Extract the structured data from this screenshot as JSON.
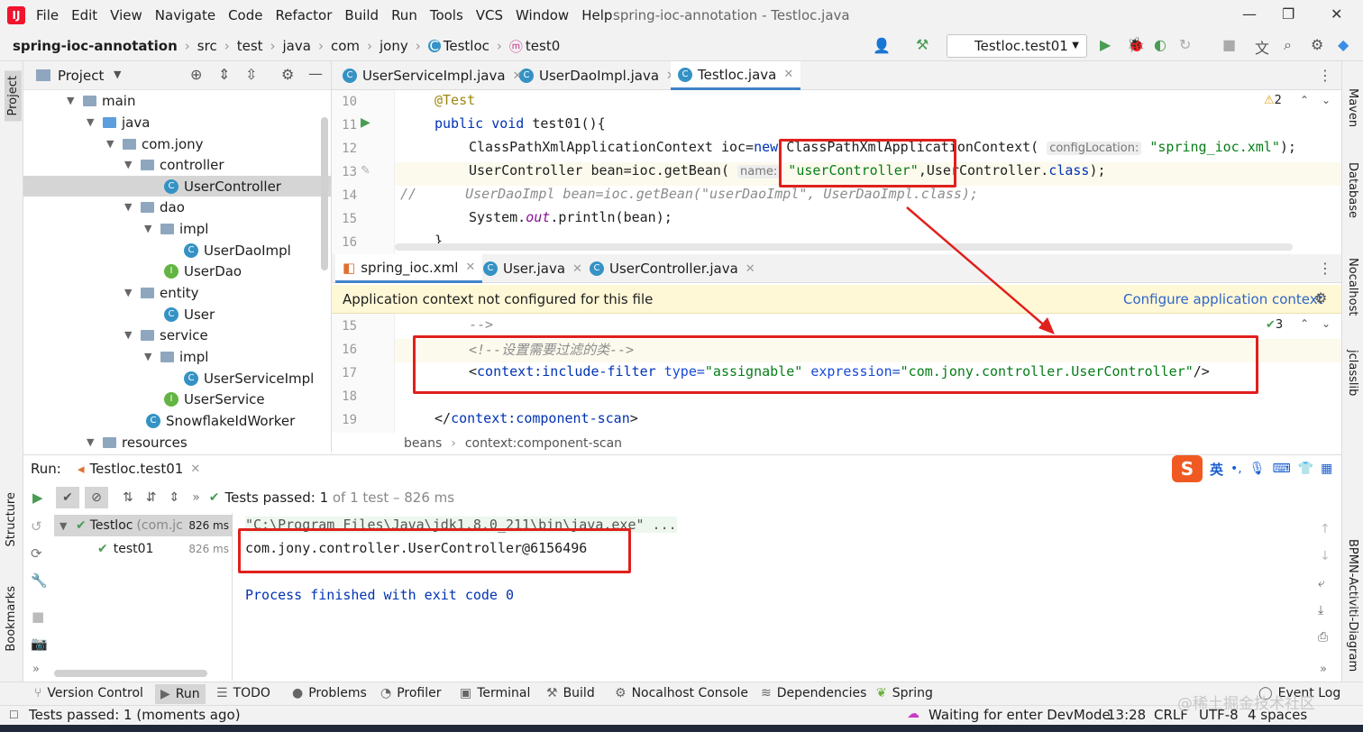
{
  "menubar": {
    "items": [
      "File",
      "Edit",
      "View",
      "Navigate",
      "Code",
      "Refactor",
      "Build",
      "Run",
      "Tools",
      "VCS",
      "Window",
      "Help"
    ],
    "title": "spring-ioc-annotation - Testloc.java"
  },
  "breadcrumbs": [
    "spring-ioc-annotation",
    "src",
    "test",
    "java",
    "com",
    "jony",
    "Testloc",
    "test0"
  ],
  "run_config": "Testloc.test01",
  "project": {
    "title": "Project",
    "tree": [
      {
        "label": "main",
        "level": 0,
        "type": "folder"
      },
      {
        "label": "java",
        "level": 1,
        "type": "folder-blue"
      },
      {
        "label": "com.jony",
        "level": 2,
        "type": "folder"
      },
      {
        "label": "controller",
        "level": 3,
        "type": "folder"
      },
      {
        "label": "UserController",
        "level": 4,
        "type": "class",
        "selected": true
      },
      {
        "label": "dao",
        "level": 3,
        "type": "folder"
      },
      {
        "label": "impl",
        "level": 4,
        "type": "folder"
      },
      {
        "label": "UserDaoImpl",
        "level": 5,
        "type": "class"
      },
      {
        "label": "UserDao",
        "level": 4,
        "type": "interface"
      },
      {
        "label": "entity",
        "level": 3,
        "type": "folder"
      },
      {
        "label": "User",
        "level": 4,
        "type": "class"
      },
      {
        "label": "service",
        "level": 3,
        "type": "folder"
      },
      {
        "label": "impl",
        "level": 4,
        "type": "folder"
      },
      {
        "label": "UserServiceImpl",
        "level": 5,
        "type": "class"
      },
      {
        "label": "UserService",
        "level": 4,
        "type": "interface"
      },
      {
        "label": "SnowflakeIdWorker",
        "level": 3,
        "type": "class"
      },
      {
        "label": "resources",
        "level": 1,
        "type": "folder"
      }
    ]
  },
  "editor_top": {
    "tabs": [
      "UserServiceImpl.java",
      "UserDaoImpl.java",
      "Testloc.java"
    ],
    "warnings": "2",
    "lines": {
      "n10": "10",
      "n11": "11",
      "n12": "12",
      "n13": "13",
      "n14": "14",
      "n15": "15",
      "n16": "16",
      "l10": "@Test",
      "l11a": "public void ",
      "l11b": "test01(){",
      "l12a": "ClassPathXmlApplicationContext ioc=",
      "l12b": "new ",
      "l12c": "ClassPathXmlApplicationContext( ",
      "l12hint": "configLocation:",
      "l12d": " \"spring_ioc.xml\"",
      ");": ");",
      "l13a": "UserController ",
      "l13b": "bean",
      "l13c": "=ioc.getBean( ",
      "l13hint": "name:",
      "l13d": " \"userController\"",
      "l13e": ",UserController.",
      "l13f": "class",
      "l13g": ");",
      "l14a": "//",
      "l14b": "UserDaoImpl bean=ioc.getBean(\"userDaoImpl\", UserDaoImpl.class);",
      "l15a": "System.",
      "l15b": "out",
      "l15c": ".println(",
      "l15d": "bean",
      "l15e": ");",
      "l16": "}"
    }
  },
  "editor_bottom": {
    "tabs": [
      "spring_ioc.xml",
      "User.java",
      "UserController.java"
    ],
    "banner_text": "Application context not configured for this file",
    "banner_link": "Configure application context",
    "checks": "3",
    "lines": {
      "n15": "15",
      "n16": "16",
      "n17": "17",
      "n18": "18",
      "n19": "19",
      "l15": "-->",
      "l16": "<!--设置需要过滤的类-->",
      "l17a": "<",
      "l17b": "context:include-filter ",
      "l17c": "type=",
      "l17d": "\"assignable\" ",
      "l17e": "expression=",
      "l17f": "\"com.jony.controller.UserController\"",
      "l17g": "/>",
      "l19a": "</",
      "l19b": "context:component-scan",
      "l19c": ">"
    },
    "breadcrumb": [
      "beans",
      "context:component-scan"
    ]
  },
  "run": {
    "label": "Run:",
    "tab": "Testloc.test01",
    "status_prefix": "Tests passed: ",
    "status_count": "1",
    "status_suffix": " of 1 test – 826 ms",
    "tree": [
      {
        "label": "Testloc",
        "pkg": "(com.jc",
        "time": "826 ms"
      },
      {
        "label": "test01",
        "pkg": "",
        "time": "826 ms"
      }
    ],
    "console": [
      "\"C:\\Program Files\\Java\\jdk1.8.0_211\\bin\\java.exe\" ...",
      "com.jony.controller.UserController@6156496",
      "",
      "Process finished with exit code 0"
    ]
  },
  "bottom_tabs": [
    "Version Control",
    "Run",
    "TODO",
    "Problems",
    "Profiler",
    "Terminal",
    "Build",
    "Nocalhost Console",
    "Dependencies",
    "Spring",
    "Event Log"
  ],
  "statusbar": {
    "left": "Tests passed: 1 (moments ago)",
    "devmode": "Waiting for enter DevMode",
    "position": "13:28",
    "line_sep": "CRLF",
    "encoding": "UTF-8",
    "indent": "4 spaces"
  },
  "side_left": [
    "Project",
    "Structure",
    "Bookmarks"
  ],
  "side_right": [
    "Maven",
    "Database",
    "Nocalhost",
    "jclasslib",
    "BPMN-Activiti-Diagram"
  ],
  "ime": [
    "英"
  ],
  "watermark": "@稀土掘金技术社区",
  "colors": {
    "accent": "#4083c9",
    "highlight_box": "#e0201c",
    "pass": "#499c54"
  }
}
